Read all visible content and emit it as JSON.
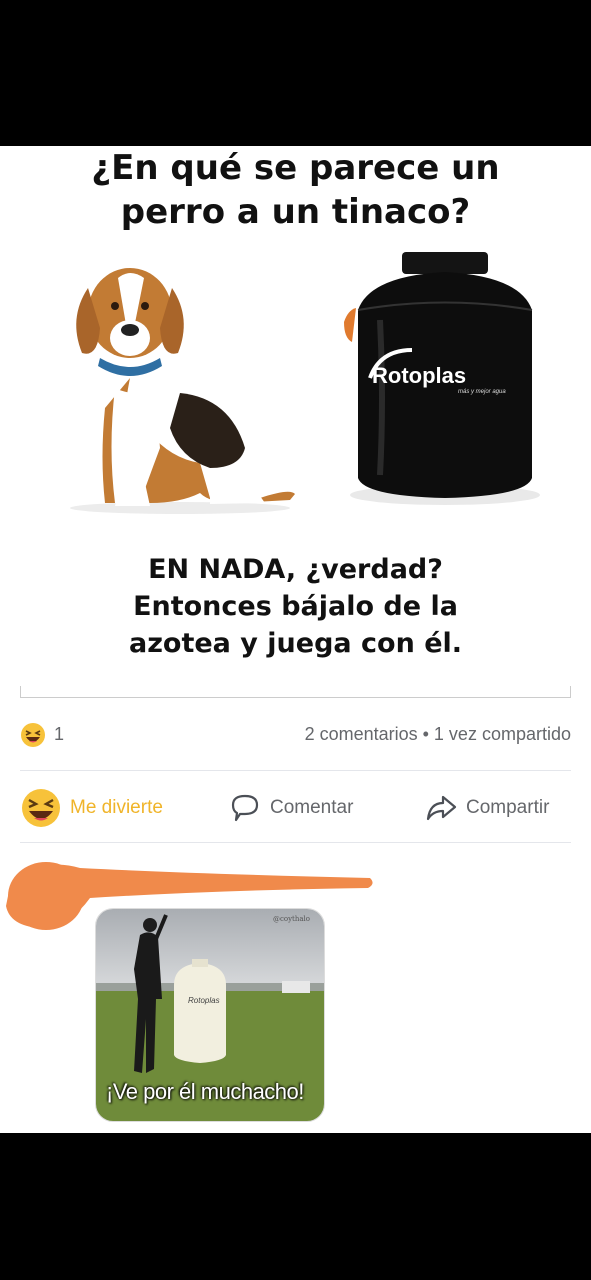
{
  "meme": {
    "question_line1": "¿En qué se parece un",
    "question_line2": "perro a un tinaco?",
    "tank_brand": "Rotoplas",
    "tank_slogan": "más y mejor agua",
    "answer_line1": "EN NADA, ¿verdad?",
    "answer_line2": "Entonces bájalo de la",
    "answer_line3": "azotea y juega con él."
  },
  "reactions": {
    "count": "1",
    "stats": "2 comentarios • 1 vez compartido"
  },
  "actions": {
    "haha_label": "Me divierte",
    "comment_label": "Comentar",
    "share_label": "Compartir"
  },
  "comment": {
    "image_caption": "¡Ve por él muchacho!",
    "image_tank_brand": "Rotoplas",
    "watermark": "@coythalo"
  },
  "icons": {
    "reaction": "haha-emoji-icon",
    "comment": "comment-bubble-icon",
    "share": "share-arrow-icon"
  },
  "colors": {
    "haha": "#f0b429",
    "muted": "#65676b",
    "redaction": "#f08a4b"
  }
}
